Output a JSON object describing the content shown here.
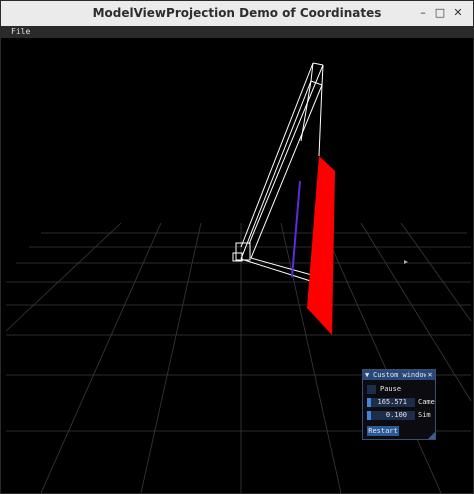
{
  "window": {
    "title": "ModelViewProjection Demo of Coordinates"
  },
  "controls": {
    "minimize": "–",
    "maximize": "□",
    "close": "✕"
  },
  "menu": {
    "file": "File"
  },
  "imgui": {
    "title": "Custom window",
    "collapse_glyph": "▼",
    "close_glyph": "✕",
    "pause_label": "Pause",
    "camera_value": "165.571",
    "camera_label": "Camera",
    "sim_value": "0.100",
    "sim_label": "Sim Speed",
    "restart_label": "Restart"
  },
  "colors": {
    "plane": "#ff0000",
    "frustum": "#ffffff",
    "grid": "#3a3a3a",
    "line": "#5a2dd9",
    "accent": "#29497a"
  }
}
